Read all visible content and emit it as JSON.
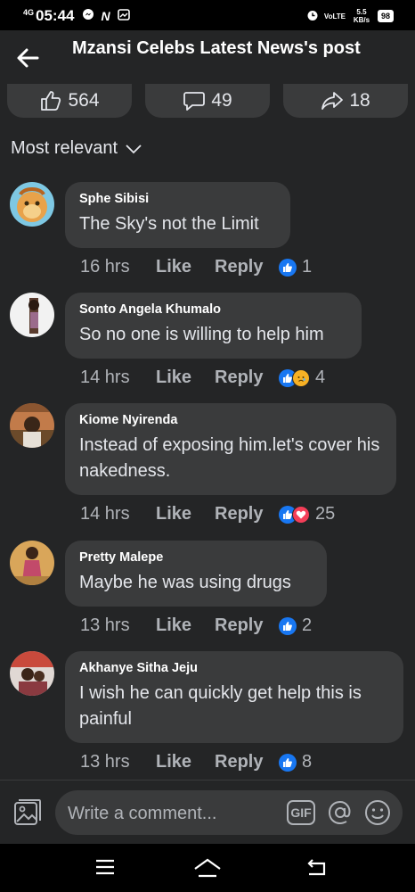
{
  "status": {
    "network": "4G",
    "time": "05:44",
    "volte": "VoLTE",
    "speed": "5.5 KB/s",
    "battery": "98"
  },
  "header": {
    "title": "Mzansi Celebs Latest News's post"
  },
  "stats": {
    "likes": "564",
    "comments": "49",
    "shares": "18"
  },
  "sort": {
    "label": "Most relevant"
  },
  "comments": [
    {
      "name": "Sphe Sibisi",
      "text": "The Sky's not the Limit",
      "time": "16 hrs",
      "like": "Like",
      "reply": "Reply",
      "reactions": [
        "like"
      ],
      "count": "1"
    },
    {
      "name": "Sonto Angela Khumalo",
      "text": "So no one is willing to help him",
      "time": "14 hrs",
      "like": "Like",
      "reply": "Reply",
      "reactions": [
        "like",
        "sad"
      ],
      "count": "4"
    },
    {
      "name": "Kiome Nyirenda",
      "text": "Instead of exposing him.let's cover his nakedness.",
      "time": "14 hrs",
      "like": "Like",
      "reply": "Reply",
      "reactions": [
        "like",
        "love"
      ],
      "count": "25"
    },
    {
      "name": "Pretty Malepe",
      "text": "Maybe he was using drugs",
      "time": "13 hrs",
      "like": "Like",
      "reply": "Reply",
      "reactions": [
        "like"
      ],
      "count": "2"
    },
    {
      "name": "Akhanye Sitha Jeju",
      "text": "I wish he can quickly get help this is painful",
      "time": "13 hrs",
      "like": "Like",
      "reply": "Reply",
      "reactions": [
        "like"
      ],
      "count": "8"
    }
  ],
  "composer": {
    "placeholder": "Write a comment...",
    "gif": "GIF"
  },
  "colors": {
    "background": "#242526",
    "bubble": "#3a3b3c",
    "like_blue": "#1877f2",
    "love_red": "#f33e58",
    "sad_yellow": "#f7b125"
  }
}
